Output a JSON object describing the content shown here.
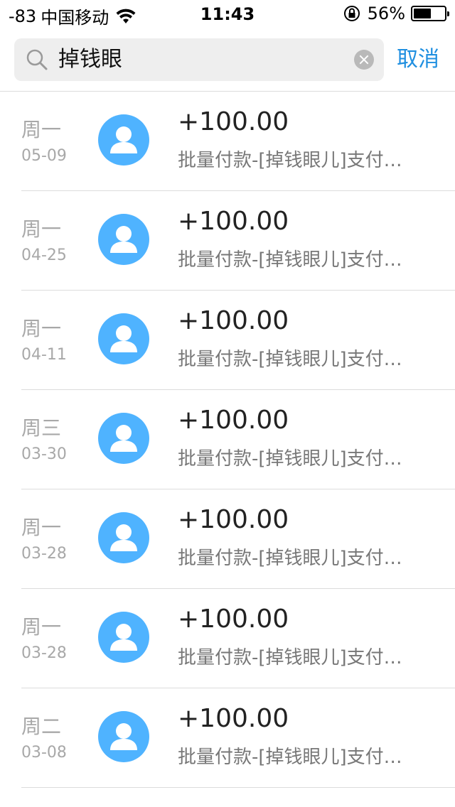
{
  "status_bar": {
    "signal": "-83",
    "carrier": "中国移动",
    "time": "11:43",
    "battery": "56%",
    "battery_level": 0.56
  },
  "search": {
    "query": "掉钱眼",
    "cancel_label": "取消"
  },
  "colors": {
    "accent": "#1f8fe0",
    "avatar": "#4fb3ff",
    "muted": "#a8a8a8"
  },
  "transactions": [
    {
      "weekday": "周一",
      "date": "05-09",
      "amount": "+100.00",
      "desc": "批量付款-[掉钱眼儿]支付…"
    },
    {
      "weekday": "周一",
      "date": "04-25",
      "amount": "+100.00",
      "desc": "批量付款-[掉钱眼儿]支付…"
    },
    {
      "weekday": "周一",
      "date": "04-11",
      "amount": "+100.00",
      "desc": "批量付款-[掉钱眼儿]支付…"
    },
    {
      "weekday": "周三",
      "date": "03-30",
      "amount": "+100.00",
      "desc": "批量付款-[掉钱眼儿]支付…"
    },
    {
      "weekday": "周一",
      "date": "03-28",
      "amount": "+100.00",
      "desc": "批量付款-[掉钱眼儿]支付…"
    },
    {
      "weekday": "周一",
      "date": "03-28",
      "amount": "+100.00",
      "desc": "批量付款-[掉钱眼儿]支付…"
    },
    {
      "weekday": "周二",
      "date": "03-08",
      "amount": "+100.00",
      "desc": "批量付款-[掉钱眼儿]支付…"
    }
  ]
}
